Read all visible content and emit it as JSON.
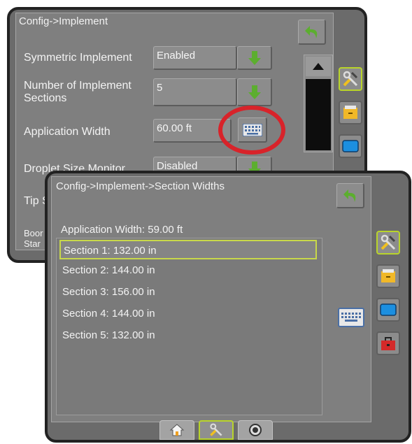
{
  "back_screen": {
    "title": "Config->Implement",
    "rows": [
      {
        "label": "Symmetric Implement",
        "value": "Enabled"
      },
      {
        "label": "Number of Implement Sections",
        "value": "5"
      },
      {
        "label": "Application Width",
        "value": "60.00 ft"
      },
      {
        "label": "Droplet Size Monitor",
        "value": "Disabled"
      },
      {
        "label": "Tip S",
        "value": ""
      },
      {
        "label": "Boor Star",
        "value": ""
      }
    ]
  },
  "front_screen": {
    "title": "Config->Implement->Section Widths",
    "application_width": "Application Width: 59.00 ft",
    "sections": [
      "Section 1: 132.00 in",
      "Section 2: 144.00 in",
      "Section 3: 156.00 in",
      "Section 4: 144.00 in",
      "Section 5: 132.00 in"
    ],
    "selected_index": 0
  },
  "icons": {
    "back": "back-arrow-icon",
    "down": "down-arrow-icon",
    "keyboard": "keyboard-icon",
    "tools": "tools-icon",
    "storage": "storage-box-icon",
    "display": "display-icon",
    "toolbox": "toolbox-icon",
    "home": "home-icon",
    "target": "target-icon"
  },
  "colors": {
    "highlight_ring": "#d8232a",
    "active_outline": "#b9d42a",
    "arrow_green": "#5cae2f"
  }
}
